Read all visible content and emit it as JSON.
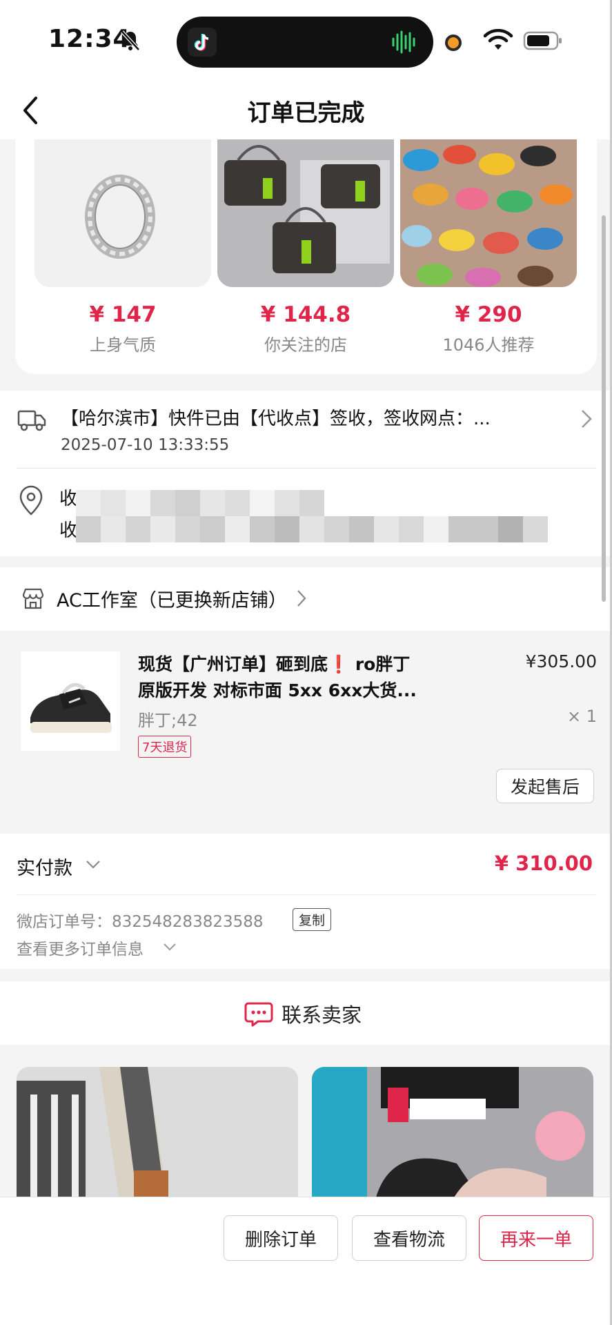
{
  "status_bar": {
    "time": "12:34"
  },
  "nav": {
    "title": "订单已完成"
  },
  "recommendations": [
    {
      "price": "¥ 147",
      "caption": "上身气质",
      "image": "silver-ring"
    },
    {
      "price": "¥ 144.8",
      "caption": "你关注的店",
      "image": "bags"
    },
    {
      "price": "¥ 290",
      "caption": "1046人推荐",
      "image": "horse-charms"
    }
  ],
  "logistics": {
    "status": "【哈尔滨市】快件已由【代收点】签收，签收网点：...",
    "time": "2025-07-10 13:33:55",
    "address_line1": "收",
    "address_line2": "收"
  },
  "shop": {
    "name": "AC工作室（已更换新店铺）"
  },
  "product": {
    "title_line1": "现货【广州订单】砸到底❗ ro胖丁",
    "title_line2": "原版开发 对标市面 5xx 6xx大货...",
    "price": "¥305.00",
    "variant": "胖丁;42",
    "quantity": "× 1",
    "badge": "7天退货",
    "after_sale_label": "发起售后"
  },
  "payment": {
    "label": "实付款",
    "amount": "¥ 310.00",
    "order_number": "微店订单号：832548283823588",
    "copy_label": "复制",
    "more_info": "查看更多订单信息"
  },
  "contact": {
    "label": "联系卖家"
  },
  "actions": {
    "delete": "删除订单",
    "track": "查看物流",
    "reorder": "再来一单"
  },
  "colors": {
    "accent": "#e0254b",
    "background": "#f4f4f4"
  }
}
